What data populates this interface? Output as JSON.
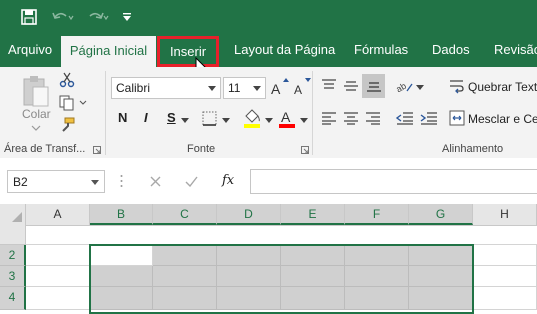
{
  "quick_access": {
    "save_icon": "save-icon",
    "undo_icon": "undo-icon",
    "redo_icon": "redo-icon",
    "customize_icon": "customize-qat-icon"
  },
  "tabs": {
    "arquivo": "Arquivo",
    "pagina_inicial": "Página Inicial",
    "inserir": "Inserir",
    "layout": "Layout da Página",
    "formulas": "Fórmulas",
    "dados": "Dados",
    "revisao": "Revisão"
  },
  "ribbon": {
    "clipboard": {
      "paste_label": "Colar",
      "group_label": "Área de Transf..."
    },
    "font": {
      "family": "Calibri",
      "size": "11",
      "bold": "N",
      "italic": "I",
      "underline": "S",
      "group_label": "Fonte",
      "fill_color": "#ffff00",
      "font_color": "#ff0000"
    },
    "alignment": {
      "wrap_text": "Quebrar Texto",
      "merge": "Mesclar e Ce",
      "group_label": "Alinhamento"
    }
  },
  "formula_bar": {
    "name_box": "B2",
    "fx": "fx",
    "formula": ""
  },
  "grid": {
    "columns": [
      "A",
      "B",
      "C",
      "D",
      "E",
      "F",
      "G",
      "H"
    ],
    "rows": [
      "2",
      "3",
      "4"
    ],
    "selection": "B2:G4",
    "accent": "#217346"
  }
}
